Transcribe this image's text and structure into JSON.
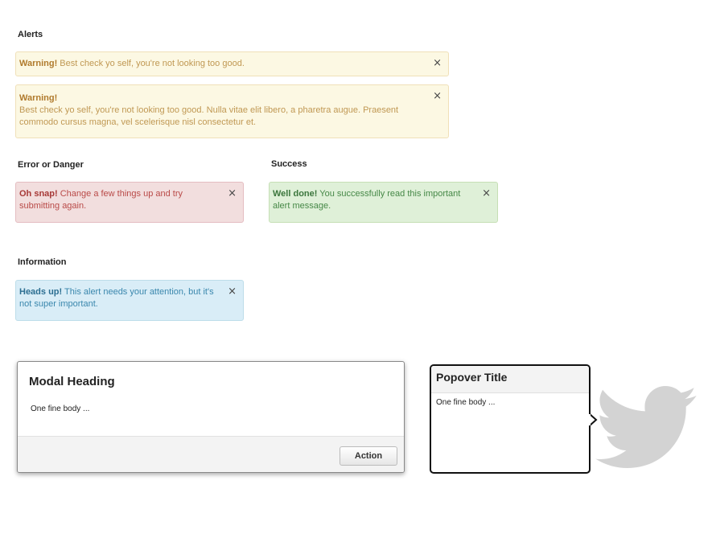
{
  "sections": {
    "alerts": "Alerts",
    "danger": "Error or Danger",
    "success": "Success",
    "info": "Information"
  },
  "alerts": {
    "close_glyph": "×",
    "warning_short": {
      "strong": "Warning!",
      "text": " Best check yo self, you're not looking too good."
    },
    "warning_long": {
      "strong": "Warning!",
      "text": "Best check yo self, you're not looking too good. Nulla vitae elit libero, a pharetra augue. Praesent commodo cursus magna, vel scelerisque nisl consectetur et."
    },
    "danger": {
      "strong": "Oh snap!",
      "text": " Change a few things up and try submitting again."
    },
    "success": {
      "strong": "Well done!",
      "text": " You successfully read this important alert message."
    },
    "info": {
      "strong": "Heads up!",
      "text": " This alert needs your attention, but it's not super important."
    }
  },
  "modal": {
    "heading": "Modal Heading",
    "body": "One fine body ...",
    "action_label": "Action"
  },
  "popover": {
    "title": "Popover Title",
    "body": "One fine body ..."
  },
  "icons": {
    "bird": "twitter-bird-icon",
    "close": "close-icon"
  },
  "colors": {
    "warning_bg": "#fcf8e3",
    "warning_text": "#c09853",
    "danger_bg": "#f2dede",
    "danger_text": "#b94a48",
    "success_bg": "#dff0d8",
    "success_text": "#468847",
    "info_bg": "#d9edf7",
    "info_text": "#3a87ad",
    "bird": "#d3d3d3"
  }
}
